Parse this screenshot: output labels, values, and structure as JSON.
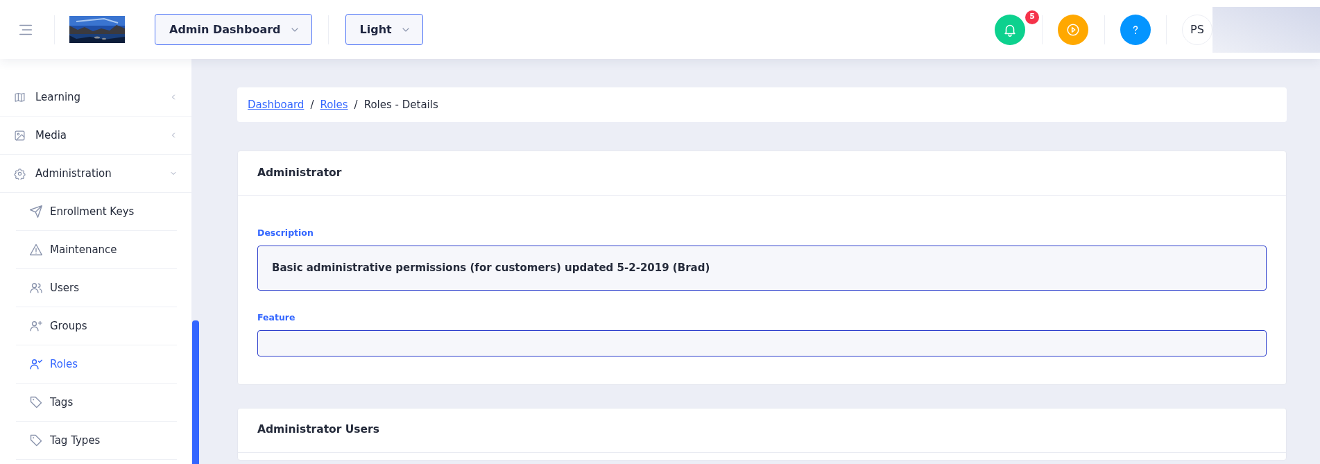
{
  "header": {
    "dashboard_select": {
      "value": "Admin Dashboard"
    },
    "theme_select": {
      "value": "Light"
    },
    "notifications": {
      "count": "5"
    },
    "avatar": {
      "initials": "PS"
    }
  },
  "sidebar": {
    "items": [
      {
        "label": "Learning",
        "expanded": false
      },
      {
        "label": "Media",
        "expanded": false
      },
      {
        "label": "Administration",
        "expanded": true,
        "children": [
          {
            "label": "Enrollment Keys",
            "selected": false
          },
          {
            "label": "Maintenance",
            "selected": false
          },
          {
            "label": "Users",
            "selected": false
          },
          {
            "label": "Groups",
            "selected": false
          },
          {
            "label": "Roles",
            "selected": true
          },
          {
            "label": "Tags",
            "selected": false
          },
          {
            "label": "Tag Types",
            "selected": false
          }
        ]
      }
    ]
  },
  "breadcrumb": {
    "separator": "/",
    "items": [
      {
        "label": "Dashboard",
        "kind": "link"
      },
      {
        "label": "Roles",
        "kind": "link"
      },
      {
        "label": "Roles - Details",
        "kind": "current"
      }
    ]
  },
  "role_card": {
    "title": "Administrator",
    "fields": [
      {
        "label": "Description",
        "value": "Basic administrative permissions (for customers) updated 5-2-2019 (Brad)"
      },
      {
        "label": "Feature"
      }
    ]
  },
  "users_card": {
    "title": "Administrator Users"
  }
}
